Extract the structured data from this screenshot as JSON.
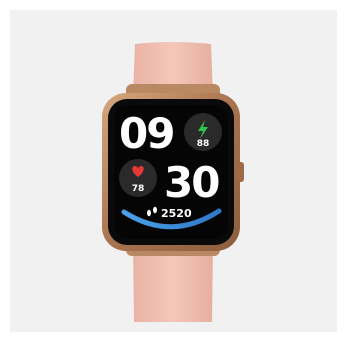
{
  "watch": {
    "hours": "09",
    "minutes": "30",
    "battery": "88",
    "heart_rate": "78",
    "steps": "2520"
  },
  "colors": {
    "background": "#f1f1f1",
    "strap": "#f1c1b3",
    "case": "#b07e5a",
    "screen": "#050505",
    "accent": "#3d8fd8",
    "battery_icon": "#30c44a",
    "heart_icon": "#e53935"
  }
}
